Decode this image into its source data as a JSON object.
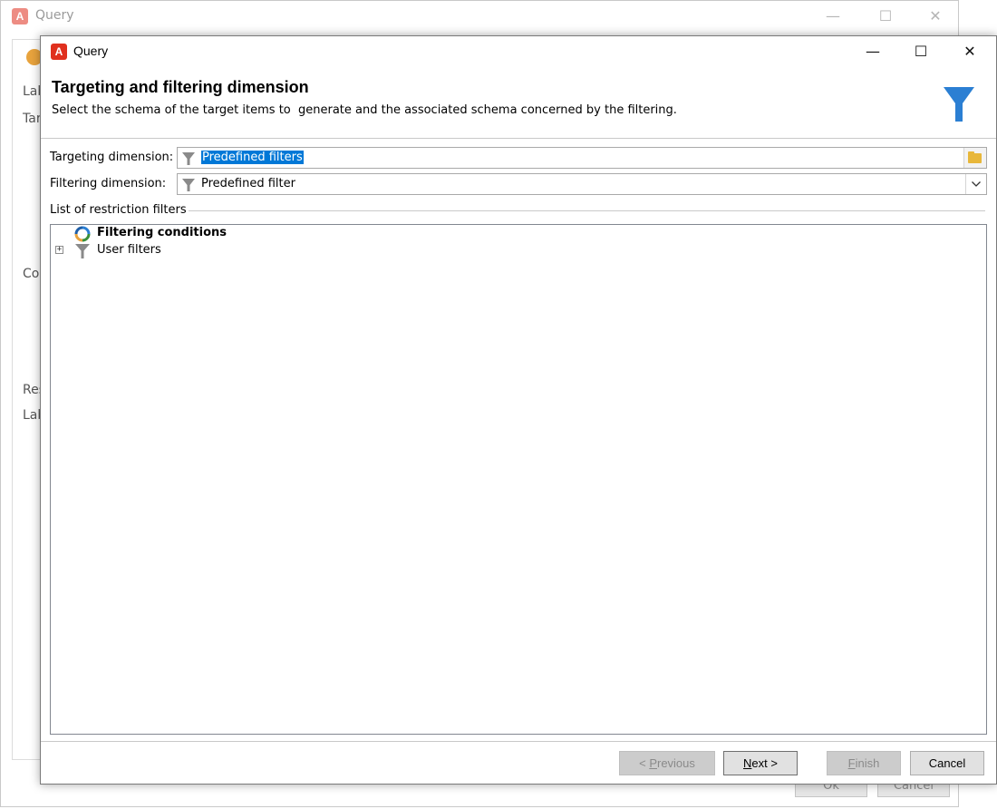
{
  "background_window": {
    "title": "Query",
    "labels": [
      "Lab",
      "Targ",
      "Cor",
      "Res",
      "Lab"
    ],
    "buttons": {
      "ok": "Ok",
      "cancel": "Cancel"
    }
  },
  "dialog": {
    "title": "Query",
    "header": {
      "title": "Targeting and filtering dimension",
      "subtitle": "Select the schema of the target items to  generate and the associated schema concerned by the filtering.",
      "icon": "funnel-icon"
    },
    "targeting": {
      "label": "Targeting dimension:",
      "value": "Predefined filters"
    },
    "filtering": {
      "label": "Filtering dimension:",
      "value": "Predefined filter"
    },
    "restriction_group": {
      "label": "List of restriction filters",
      "items": [
        {
          "label": "Filtering conditions",
          "icon": "filtering-conditions-icon",
          "bold": true
        },
        {
          "label": "User filters",
          "icon": "funnel-icon",
          "expander": "+"
        }
      ]
    },
    "buttons": {
      "previous": {
        "pre": "< ",
        "accel": "P",
        "rest": "revious",
        "enabled": false
      },
      "next": {
        "accel": "N",
        "rest": "ext >",
        "enabled": true
      },
      "finish": {
        "accel": "F",
        "rest": "inish",
        "enabled": false
      },
      "cancel": {
        "label": "Cancel",
        "enabled": true
      }
    }
  },
  "colors": {
    "brand_red": "#e0301e",
    "selection_blue": "#0078d7",
    "funnel_blue": "#2b7fd3",
    "funnel_gray": "#8a8a8a",
    "folder_yellow": "#e8b73a"
  }
}
